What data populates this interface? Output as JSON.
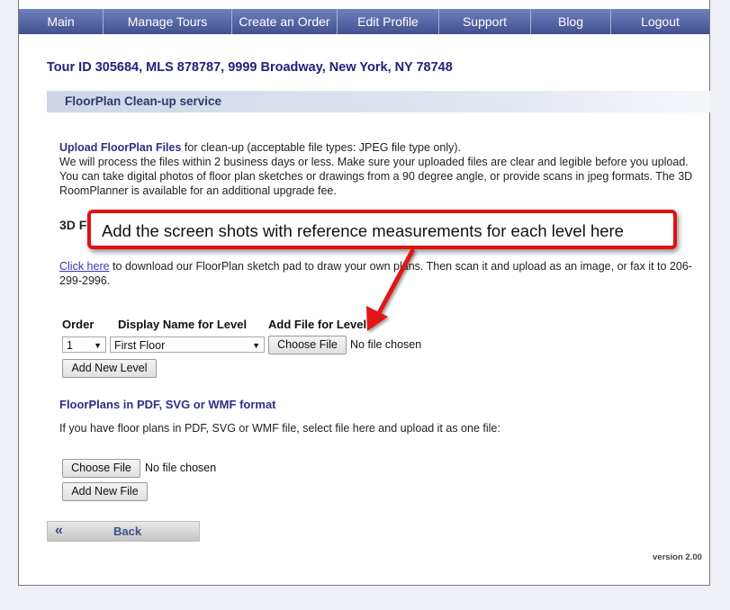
{
  "nav": {
    "items": [
      "Main",
      "Manage Tours",
      "Create an Order",
      "Edit Profile",
      "Support",
      "Blog",
      "Logout"
    ]
  },
  "tour_title": "Tour ID 305684, MLS 878787, 9999 Broadway, New York, NY 78748",
  "section_title": "FloorPlan Clean-up service",
  "intro": {
    "heading": "Upload FloorPlan Files",
    "heading_suffix": " for clean-up (acceptable file types: JPEG file type only).",
    "body": "We will process the files within 2 business days or less. Make sure your uploaded files are clear and legible before you upload. You can take digital photos of floor plan sketches or drawings from a 90 degree angle, or provide scans in jpeg formats. The 3D RoomPlanner is available for an additional upgrade fee."
  },
  "roomplanner_heading": "3D F",
  "click_line": {
    "link": "Click here",
    "text": " to download our FloorPlan sketch pad to draw your own plans. Then scan it and upload as an image, or fax it to 206-299-2996."
  },
  "levels": {
    "col_order": "Order",
    "col_display": "Display Name for Level",
    "col_file": "Add File for Level",
    "order_value": "1",
    "display_value": "First Floor",
    "choose_file": "Choose File",
    "no_file": "No file chosen",
    "add_level": "Add New Level"
  },
  "pdf": {
    "heading": "FloorPlans in PDF, SVG or WMF format",
    "desc": "If you have floor plans in PDF, SVG or WMF file, select file here and upload it as one file:",
    "choose_file": "Choose File",
    "no_file": "No file chosen",
    "add_file": "Add New File"
  },
  "back": {
    "icon": "double-chevron-left-icon",
    "label": "Back"
  },
  "version": "version 2.00",
  "annotation": {
    "text": "Add the screen shots with reference measurements for each level here",
    "color": "#e11212"
  },
  "colors": {
    "nav": "#4a5796",
    "title": "#20237a",
    "accent_red": "#e11212"
  }
}
